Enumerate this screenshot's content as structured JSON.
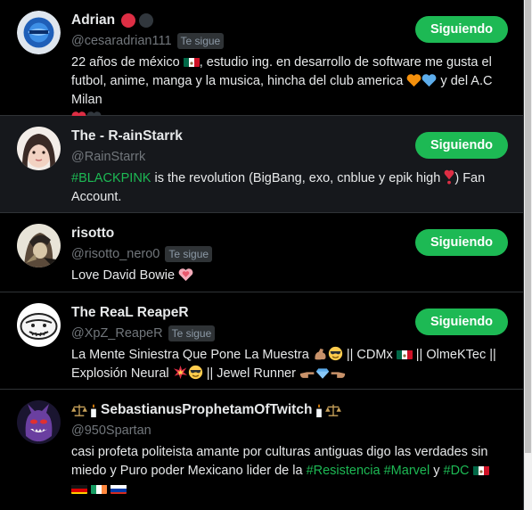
{
  "follow_label": "Siguiendo",
  "follows_you_label": "Te sigue",
  "users": [
    {
      "name": "Adrian",
      "handle": "@cesaradrian111",
      "follows_you": true,
      "bio_parts": [
        "22 años de méxico",
        ", estudio ing. en desarrollo de software me gusta el futbol, anime, manga y la musica, hincha del club america",
        "y del A.C Milan"
      ]
    },
    {
      "name": "The - R-ainStarrk",
      "handle": "@RainStarrk",
      "follows_you": false,
      "bio_hashtag": "#BLACKPINK",
      "bio_parts": [
        " is the revolution (BigBang, exo, cnblue y epik high",
        ") Fan Account."
      ]
    },
    {
      "name": "risotto",
      "handle": "@risotto_nero0",
      "follows_you": true,
      "bio_parts": [
        "Love David Bowie"
      ]
    },
    {
      "name": "The ReaL ReapeR",
      "handle": "@XpZ_ReapeR",
      "follows_you": true,
      "bio_parts": [
        "La Mente Siniestra Que Pone La Muestra",
        "|| CDMx",
        "|| OlmeKTec || Explosión Neural",
        "|| Jewel Runner"
      ]
    },
    {
      "name": "SebastianusProphetamOfTwitch",
      "handle": "@950Spartan",
      "follows_you": false,
      "bio_parts": [
        "casi profeta politeista amante por culturas antiguas digo las verdades sin miedo y Puro poder Mexicano lider de la",
        "y"
      ],
      "bio_hashtags": [
        "#Resistencia",
        "#Marvel",
        "#DC"
      ]
    }
  ],
  "colors": {
    "accent": "#1db954",
    "hover_row": "#16181c"
  }
}
